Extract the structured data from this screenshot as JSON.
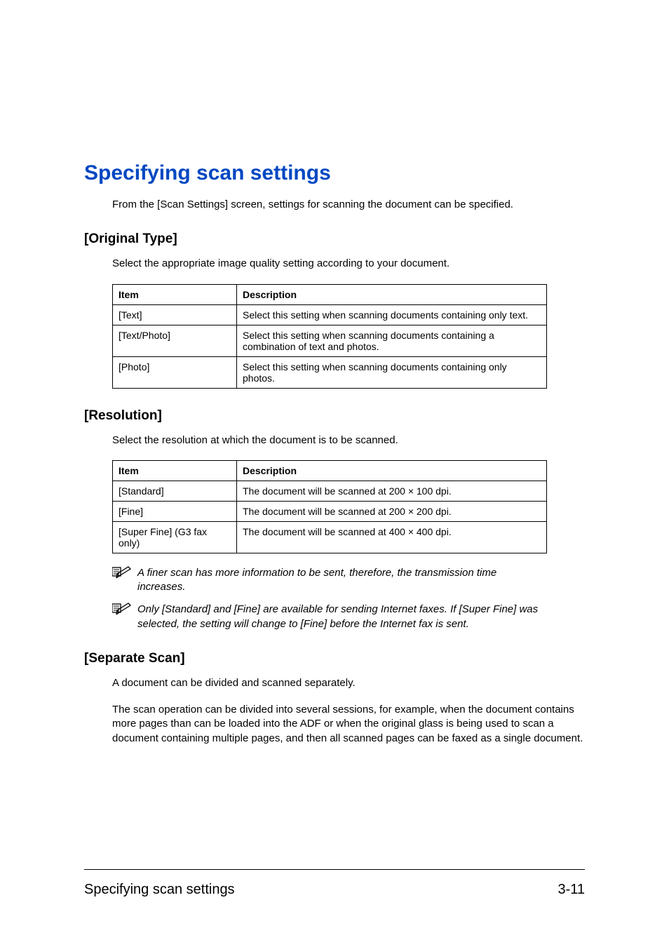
{
  "title": "Specifying scan settings",
  "intro": "From the [Scan Settings] screen, settings for scanning the document can be specified.",
  "sections": {
    "original_type": {
      "heading": "[Original Type]",
      "desc": "Select the appropriate image quality setting according to your document.",
      "table": {
        "head_item": "Item",
        "head_desc": "Description",
        "rows": [
          {
            "item": "[Text]",
            "desc": "Select this setting when scanning documents containing only text."
          },
          {
            "item": "[Text/Photo]",
            "desc": "Select this setting when scanning documents containing a combination of text and photos."
          },
          {
            "item": "[Photo]",
            "desc": "Select this setting when scanning documents containing only photos."
          }
        ]
      }
    },
    "resolution": {
      "heading": "[Resolution]",
      "desc": "Select the resolution at which the document is to be scanned.",
      "table": {
        "head_item": "Item",
        "head_desc": "Description",
        "rows": [
          {
            "item": "[Standard]",
            "desc": "The document will be scanned at 200 × 100 dpi."
          },
          {
            "item": "[Fine]",
            "desc": "The document will be scanned at 200 × 200 dpi."
          },
          {
            "item": "[Super Fine] (G3 fax only)",
            "desc": "The document will be scanned at 400 × 400 dpi."
          }
        ]
      },
      "note1": "A finer scan has more information to be sent, therefore, the transmission time increases.",
      "note2": "Only [Standard] and [Fine] are available for sending Internet faxes. If [Super Fine] was selected, the setting will change to [Fine] before the Internet fax is sent."
    },
    "separate_scan": {
      "heading": "[Separate Scan]",
      "p1": "A document can be divided and scanned separately.",
      "p2": "The scan operation can be divided into several sessions, for example, when the document contains more pages than can be loaded into the ADF or when the original glass is being used to scan a document containing multiple pages, and then all scanned pages can be faxed as a single document."
    }
  },
  "footer": {
    "left": "Specifying scan settings",
    "right": "3-11"
  }
}
